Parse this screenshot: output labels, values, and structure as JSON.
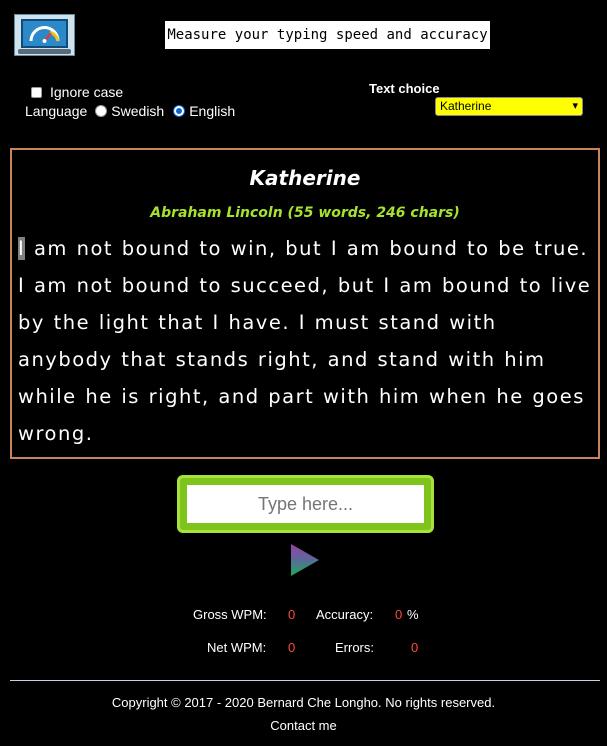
{
  "header": {
    "logo_icon": "speedometer-laptop-icon",
    "banner": "Measure your typing speed and accuracy"
  },
  "options": {
    "ignore_case_label": "Ignore case",
    "ignore_case_checked": false,
    "language_label": "Language",
    "languages": [
      {
        "label": "Swedish",
        "selected": false
      },
      {
        "label": "English",
        "selected": true
      }
    ],
    "text_choice_label": "Text choice",
    "text_choice_selected": "Katherine",
    "select_color": "#ffff00"
  },
  "quote": {
    "title": "Katherine",
    "author": "Abraham Lincoln (55 words, 246 chars)",
    "first_char": "I",
    "rest": " am not bound to win, but I am bound to be true. I am not bound to succeed, but I am bound to live by the light that I have. I must stand with anybody that stands right, and stand with him while he is right, and part with him when he goes wrong.",
    "border_color": "#c9845b",
    "author_color": "#a6e22e"
  },
  "input": {
    "placeholder": "Type here...",
    "frame_color": "#7ec41c"
  },
  "play_icon": "play-triangle-icon",
  "stats": {
    "gross_wpm_label": "Gross WPM:",
    "gross_wpm": "0",
    "accuracy_label": "Accuracy:",
    "accuracy": "0",
    "accuracy_unit": "%",
    "net_wpm_label": "Net WPM:",
    "net_wpm": "0",
    "errors_label": "Errors:",
    "errors": "0",
    "value_color": "#ff4a3d"
  },
  "footer": {
    "copyright": "Copyright © 2017 - 2020 Bernard Che Longho. No rights reserved.",
    "contact": "Contact me"
  }
}
